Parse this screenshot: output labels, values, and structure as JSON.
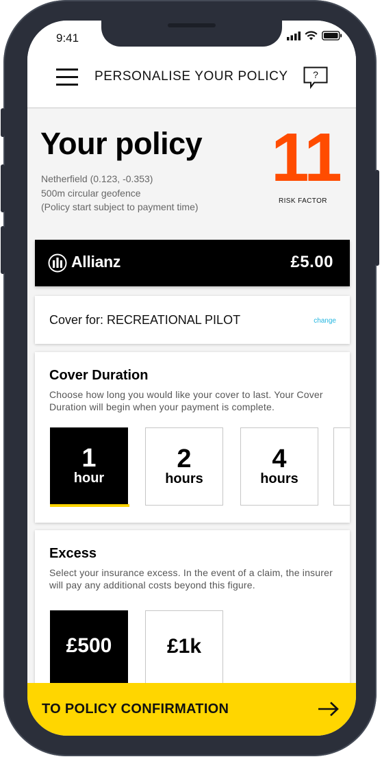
{
  "status_bar": {
    "time": "9:41"
  },
  "header": {
    "title": "PERSONALISE YOUR POLICY",
    "help_icon_text": "?"
  },
  "policy": {
    "title": "Your policy",
    "location": "Netherfield (0.123, -0.353)",
    "geofence": "500m circular geofence",
    "note": "(Policy start subject to payment time)",
    "risk_value": "11",
    "risk_label": "RISK FACTOR",
    "risk_color": "#ff4c00"
  },
  "insurer": {
    "name": "Allianz",
    "price": "£5.00"
  },
  "cover": {
    "text": "Cover for: RECREATIONAL PILOT",
    "change_label": "change"
  },
  "duration": {
    "title": "Cover Duration",
    "description": "Choose how long you would like your cover to last. Your Cover Duration will begin when your payment is complete.",
    "options": [
      {
        "value": "1",
        "unit": "hour",
        "selected": true
      },
      {
        "value": "2",
        "unit": "hours",
        "selected": false
      },
      {
        "value": "4",
        "unit": "hours",
        "selected": false
      }
    ]
  },
  "excess": {
    "title": "Excess",
    "description": "Select your insurance excess. In the event of a claim, the insurer will pay any additional costs beyond this figure.",
    "options": [
      {
        "label": "£500",
        "selected": true
      },
      {
        "label": "£1k",
        "selected": false
      }
    ]
  },
  "cta": {
    "label": "TO POLICY CONFIRMATION",
    "color": "#ffd600"
  },
  "colors": {
    "accent_yellow": "#ffd500",
    "link_blue": "#23b6e0",
    "frame": "#2b2f3a"
  }
}
